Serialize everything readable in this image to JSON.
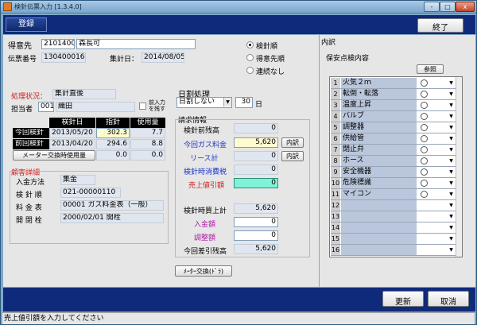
{
  "window": {
    "title": "検針伝票入力 [1.3.4.0]",
    "controls": [
      "-",
      "□",
      "x"
    ]
  },
  "header": {
    "register_label": "登録",
    "exit_label": "終了"
  },
  "customer": {
    "customer_label": "得意先",
    "customer_code": "21014000",
    "customer_name": "森長可",
    "slip_label": "伝票番号",
    "slip_no": "1304000161",
    "agg_date_label": "集計日：",
    "agg_date": "2014/08/05"
  },
  "sort_options": {
    "options": [
      "検針順",
      "得意先順",
      "連続なし"
    ],
    "selected": 0
  },
  "status_section": {
    "status_label": "処理状況：",
    "status_value": "集計直後",
    "staff_label": "担当者",
    "staff_code": "001",
    "staff_name": "織田",
    "carry_check_label_1": "前入力",
    "carry_check_label_2": "を残す"
  },
  "history": {
    "headers": [
      "検針日",
      "指針",
      "使用量"
    ],
    "rows": [
      {
        "label": "今回検針",
        "date": "2013/05/20",
        "reading": "302.3",
        "usage": "7.7"
      },
      {
        "label": "前回検針",
        "date": "2013/04/20",
        "reading": "294.6",
        "usage": "8.8"
      }
    ],
    "meter_change_label": "メーター交換時使用量",
    "meter_change_reading": "0.0",
    "meter_change_usage": "0.0"
  },
  "customer_detail": {
    "title": "顧客詳細",
    "payment_label": "入金方法",
    "payment_value": "集金",
    "order_label": "検 針 順",
    "order_value": "021-00000110",
    "rate_label": "料 金 表",
    "rate_value": "00001 ガス料金表（一般）",
    "open_label": "開 閉 栓",
    "open_value": "2000/02/01 開栓"
  },
  "prorate": {
    "title": "日割処理",
    "mode": "日割しない",
    "days": "30",
    "days_unit": "日"
  },
  "billing": {
    "title": "請求情報",
    "prev_balance_label": "検針前残高",
    "prev_balance": "0",
    "gas_fee_label": "今回ガス料金",
    "gas_fee": "5,620",
    "gas_fee_btn": "内訳",
    "lease_label": "リース計",
    "lease": "0",
    "lease_btn": "内訳",
    "consumption_tax_label": "検針時消費税",
    "consumption_tax": "0",
    "discount_label": "売上値引額",
    "discount": "0",
    "sales_total_label": "検針時買上計",
    "sales_total": "5,620",
    "payment_label": "入金額",
    "payment": "0",
    "adjust_label": "調整額",
    "adjust": "0",
    "balance_label": "今回差引残高",
    "balance": "5,620"
  },
  "meter_change_btn": "ﾒｰﾀｰ交換(ﾄﾞﾗ)",
  "breakdown": {
    "title": "内訳",
    "inspection_title": "保安点検内容",
    "reference_btn": "参照",
    "items": [
      {
        "no": "1",
        "name": "火気２ｍ",
        "mark": true
      },
      {
        "no": "2",
        "name": "転倒・転落",
        "mark": true
      },
      {
        "no": "3",
        "name": "温度上昇",
        "mark": true
      },
      {
        "no": "4",
        "name": "バルブ",
        "mark": true
      },
      {
        "no": "5",
        "name": "調整器",
        "mark": true
      },
      {
        "no": "6",
        "name": "供給管",
        "mark": true
      },
      {
        "no": "7",
        "name": "閉止弁",
        "mark": true
      },
      {
        "no": "8",
        "name": "ホース",
        "mark": true
      },
      {
        "no": "9",
        "name": "安全機器",
        "mark": true
      },
      {
        "no": "10",
        "name": "危険標識",
        "mark": true
      },
      {
        "no": "11",
        "name": "マイコン",
        "mark": true
      },
      {
        "no": "12",
        "name": "",
        "mark": false
      },
      {
        "no": "13",
        "name": "",
        "mark": false
      },
      {
        "no": "14",
        "name": "",
        "mark": false
      },
      {
        "no": "15",
        "name": "",
        "mark": false
      },
      {
        "no": "16",
        "name": "",
        "mark": false
      }
    ]
  },
  "footer": {
    "update_label": "更新",
    "cancel_label": "取消"
  },
  "statusbar": {
    "message": "売上値引額を入力してください"
  },
  "colors": {
    "header_bg": "#0f2a7a",
    "accent_red": "#d02020",
    "accent_blue": "#1a36c8",
    "highlight": "#7ff2d7"
  }
}
